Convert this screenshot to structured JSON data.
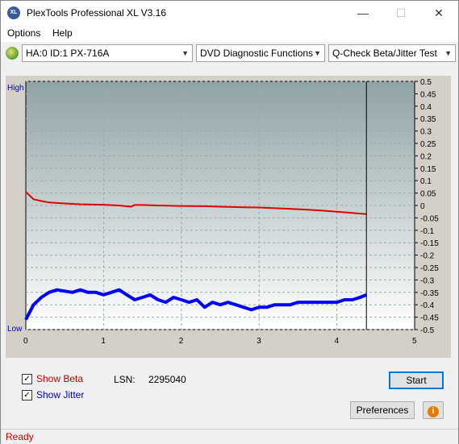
{
  "window": {
    "title": "PlexTools Professional XL V3.16",
    "icon_text": "XL"
  },
  "menu": {
    "options": "Options",
    "help": "Help"
  },
  "toolbar": {
    "drive": "HA:0 ID:1  PX-716A",
    "function": "DVD Diagnostic Functions",
    "test": "Q-Check Beta/Jitter Test"
  },
  "chart_data": {
    "type": "line",
    "y_left_high": "High",
    "y_left_low": "Low",
    "x_ticks": [
      "0",
      "1",
      "2",
      "3",
      "4",
      "5"
    ],
    "y_ticks": [
      "0.5",
      "0.45",
      "0.4",
      "0.35",
      "0.3",
      "0.25",
      "0.2",
      "0.15",
      "0.1",
      "0.05",
      "0",
      "-0.05",
      "-0.1",
      "-0.15",
      "-0.2",
      "-0.25",
      "-0.3",
      "-0.35",
      "-0.4",
      "-0.45",
      "-0.5"
    ],
    "xlim": [
      0,
      5
    ],
    "ylim": [
      -0.5,
      0.5
    ],
    "cursor_x": 4.38,
    "grid": true,
    "series": [
      {
        "color": "#e00000",
        "x": [
          0.0,
          0.05,
          0.1,
          0.2,
          0.3,
          0.5,
          0.7,
          1.0,
          1.2,
          1.35,
          1.4,
          1.5,
          1.7,
          2.0,
          2.3,
          2.5,
          2.8,
          3.0,
          3.3,
          3.5,
          3.8,
          4.0,
          4.2,
          4.38
        ],
        "y": [
          0.055,
          0.04,
          0.025,
          0.018,
          0.012,
          0.008,
          0.005,
          0.003,
          0.0,
          -0.005,
          0.002,
          0.002,
          0.0,
          -0.002,
          -0.003,
          -0.005,
          -0.007,
          -0.008,
          -0.012,
          -0.015,
          -0.02,
          -0.025,
          -0.03,
          -0.035
        ]
      },
      {
        "color": "#0000ff",
        "x": [
          0.0,
          0.05,
          0.1,
          0.2,
          0.3,
          0.4,
          0.5,
          0.6,
          0.7,
          0.8,
          0.9,
          1.0,
          1.1,
          1.2,
          1.3,
          1.4,
          1.5,
          1.6,
          1.7,
          1.8,
          1.9,
          2.0,
          2.1,
          2.2,
          2.3,
          2.4,
          2.5,
          2.6,
          2.7,
          2.8,
          2.9,
          3.0,
          3.1,
          3.2,
          3.3,
          3.4,
          3.5,
          3.6,
          3.7,
          3.8,
          3.9,
          4.0,
          4.1,
          4.2,
          4.3,
          4.38
        ],
        "y": [
          -0.46,
          -0.43,
          -0.4,
          -0.37,
          -0.35,
          -0.34,
          -0.345,
          -0.35,
          -0.34,
          -0.35,
          -0.35,
          -0.36,
          -0.35,
          -0.34,
          -0.36,
          -0.38,
          -0.37,
          -0.36,
          -0.38,
          -0.39,
          -0.37,
          -0.38,
          -0.39,
          -0.38,
          -0.41,
          -0.39,
          -0.4,
          -0.39,
          -0.4,
          -0.41,
          -0.42,
          -0.41,
          -0.41,
          -0.4,
          -0.4,
          -0.4,
          -0.39,
          -0.39,
          -0.39,
          -0.39,
          -0.39,
          -0.39,
          -0.38,
          -0.38,
          -0.37,
          -0.36
        ]
      }
    ]
  },
  "controls": {
    "show_beta": "Show Beta",
    "show_jitter": "Show Jitter",
    "lsn_label": "LSN:",
    "lsn_value": "2295040",
    "start": "Start",
    "preferences": "Preferences",
    "info_icon": "i",
    "beta_color": "#c00000",
    "jitter_color": "#0000c0"
  },
  "status": {
    "text": "Ready"
  }
}
